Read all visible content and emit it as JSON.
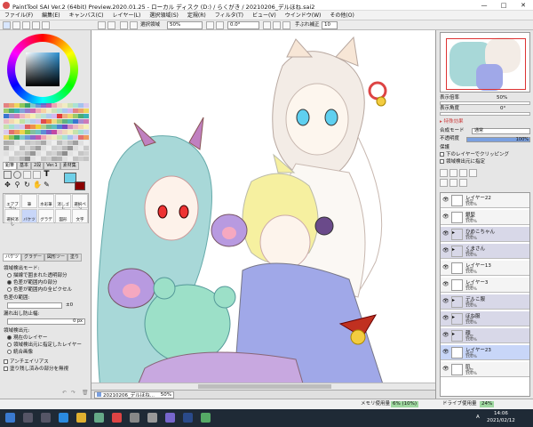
{
  "window": {
    "title": "PaintTool SAI Ver.2 (64bit) Preview.2020.01.25 - ローカル ディスク (D:) / らくがき / 20210206_デルほね.sai2"
  },
  "menu": [
    "ファイル(F)",
    "編集(E)",
    "キャンバス(C)",
    "レイヤー(L)",
    "選択領域(S)",
    "定規(R)",
    "フィルタ(T)",
    "ビュー(V)",
    "ウインドウ(W)",
    "その他(O)"
  ],
  "toolbar": {
    "selection_label": "選択領域",
    "zoom": "50%",
    "angle": "0.0°",
    "stabilizer_label": "手ぶれ補正",
    "stabilizer_value": "10"
  },
  "tool_tabs": [
    "鉛筆",
    "基本",
    "2段",
    "Ver.1",
    "素材集"
  ],
  "tools": [
    "エアブラシ",
    "筆",
    "水彩筆",
    "消しゴム",
    "選択ペン",
    "選択消し",
    "バケツ",
    "グラデ",
    "図形",
    "文字"
  ],
  "tool_subtabs": [
    "バケツ",
    "グラデー",
    "図形ツー",
    "塗り"
  ],
  "fill_settings": {
    "detect_mode_label": "領域検出モード:",
    "detect_modes": [
      "描線で囲まれた透明部分",
      "色差が範囲内の部分",
      "色差が範囲内の全ピクセル"
    ],
    "color_range_label": "色差の範囲:",
    "color_range_value": "±0",
    "overflow_label": "漏れ出し防止幅:",
    "overflow_value": "0 px",
    "source_label": "領域検出元:",
    "sources": [
      "現在のレイヤー",
      "領域検出元に指定したレイヤー",
      "統合画像"
    ],
    "antialias_label": "アンチエイリアス",
    "unpainted_label": "塗り残し済みの部分を無視"
  },
  "navigator": {
    "zoom_label": "表示倍率",
    "zoom_value": "50%",
    "angle_label": "表示角度",
    "angle_value": "0°"
  },
  "effects_label": "特殊効果",
  "layer_props": {
    "blend_label": "合成モード",
    "blend_value": "通常",
    "opacity_label": "不透明度",
    "opacity_value": "100%",
    "opacity": 1.0,
    "protect_label": "保護",
    "clip_label": "下のレイヤーでクリッピング",
    "source_label": "領域検出元に指定"
  },
  "layers": [
    {
      "name": "レイヤー22",
      "mode": "通常",
      "opacity": "100%",
      "type": "layer"
    },
    {
      "name": "銀髪",
      "mode": "通常",
      "opacity": "100%",
      "type": "layer"
    },
    {
      "name": "ひめこちゃん",
      "mode": "通常",
      "opacity": "100%",
      "type": "folder"
    },
    {
      "name": "くまさん",
      "mode": "通常",
      "opacity": "100%",
      "type": "folder"
    },
    {
      "name": "レイヤー13",
      "mode": "通常",
      "opacity": "100%",
      "type": "layer"
    },
    {
      "name": "レイヤー3",
      "mode": "通常",
      "opacity": "100%",
      "type": "layer"
    },
    {
      "name": "デルこ服",
      "mode": "通常",
      "opacity": "100%",
      "type": "folder"
    },
    {
      "name": "ほね服",
      "mode": "通常",
      "opacity": "100%",
      "type": "folder"
    },
    {
      "name": "顔",
      "mode": "通常",
      "opacity": "100%",
      "type": "folder"
    },
    {
      "name": "レイヤー23",
      "mode": "通常",
      "opacity": "100%",
      "type": "selected"
    },
    {
      "name": "肌",
      "mode": "通常",
      "opacity": "100%",
      "type": "layer"
    }
  ],
  "doc_tab": {
    "name": "20210206_デルほね...",
    "zoom": "50%"
  },
  "status": {
    "memory_label": "メモリ使用量",
    "memory_value": "6% (10%)",
    "drive_label": "ドライブ使用量",
    "drive_value": "24%"
  },
  "taskbar": {
    "time": "14:06",
    "date": "2021/02/12",
    "ime": "A"
  },
  "colors": {
    "accent": "#7aa0e0",
    "title_bar": "#ffffff",
    "taskbar": "#1f2a36",
    "selected_layer": "#c8d6f8",
    "primary_color": "#6fd0e8",
    "secondary_color": "#8b0000"
  }
}
